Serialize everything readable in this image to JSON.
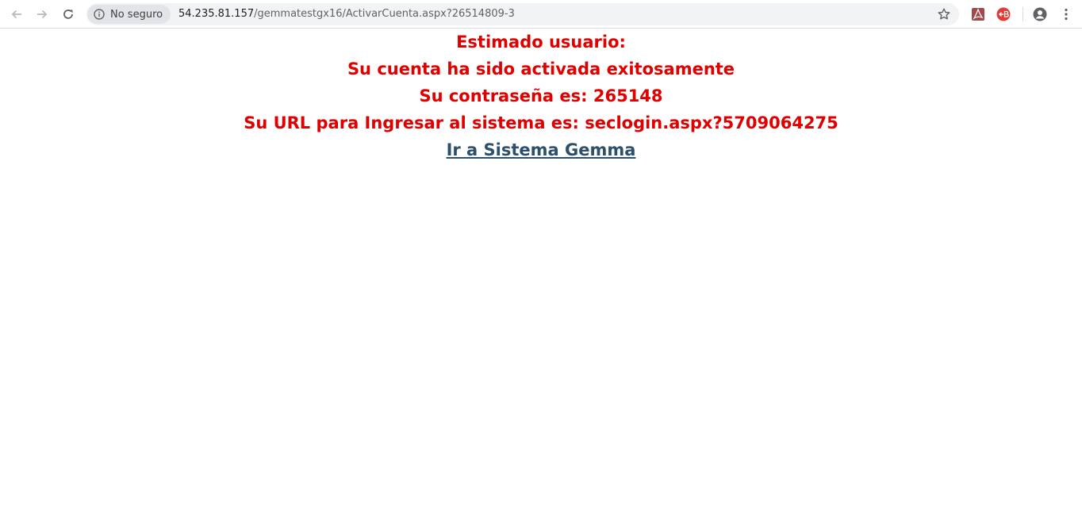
{
  "browser": {
    "security_label": "No seguro",
    "url_host": "54.235.81.157",
    "url_path": "/gemmatestgx16/ActivarCuenta.aspx?26514809-3",
    "icons": [
      "back-arrow-icon",
      "forward-arrow-icon",
      "reload-icon",
      "info-icon",
      "star-icon",
      "pdf-extension-icon",
      "extension-icon",
      "account-icon",
      "menu-icon"
    ]
  },
  "page": {
    "greeting": "Estimado usuario:",
    "activation_message": "Su cuenta ha sido activada exitosamente",
    "password_message": "Su contraseña es: 265148",
    "url_message": "Su URL para Ingresar al sistema es: seclogin.aspx?5709064275",
    "link_label": "Ir a Sistema Gemma"
  },
  "colors": {
    "message_text": "#e00000",
    "link_text": "#2c4f6b"
  }
}
